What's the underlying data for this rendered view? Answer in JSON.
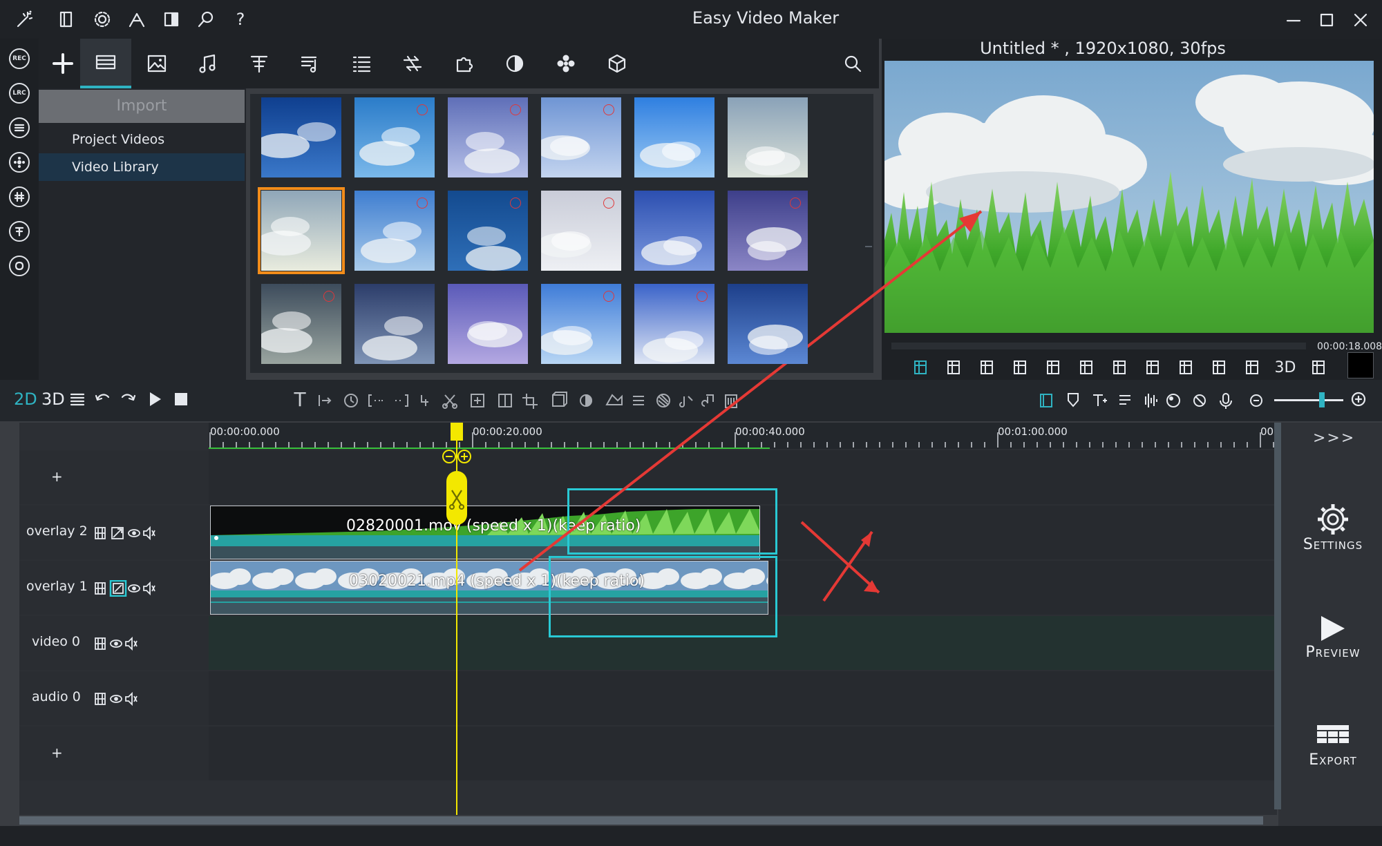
{
  "window": {
    "title": "Easy Video Maker",
    "min_label": "—",
    "max_label": "☐",
    "close_label": "✕"
  },
  "titlebar_icons": [
    "magic-wand-icon",
    "book-icon",
    "gear-icon",
    "pen-icon",
    "split-icon",
    "search-icon",
    "help-icon"
  ],
  "titlebar_help": "?",
  "rail": {
    "rec_label": "REC",
    "lrc_label": "LRC"
  },
  "library": {
    "import_label": "Import",
    "items": [
      {
        "label": "Project Videos"
      },
      {
        "label": "Video Library"
      }
    ],
    "selected_index": 1
  },
  "preview": {
    "title": "Untitled * , 1920x1080, 30fps",
    "time": "00:00:18.008",
    "mode_3d": "3D"
  },
  "timeline_toolbar": {
    "mode_2d": "2D",
    "mode_3d": "3D",
    "text_tool": "T"
  },
  "ruler": {
    "ticks": [
      "00:00:00.000",
      "00:00:20.000",
      "00:00:40.000",
      "00:01:00.000",
      "00:"
    ]
  },
  "tracks": [
    {
      "label": "+"
    },
    {
      "label": "overlay 2",
      "clip": "02820001.mov (speed x 1)(keep ratio)"
    },
    {
      "label": "overlay 1",
      "clip": "03020021.mp4 (speed x 1)(keep ratio)"
    },
    {
      "label": "video 0"
    },
    {
      "label": "audio 0"
    },
    {
      "label": "+"
    }
  ],
  "right_panel": {
    "expand": ">>>",
    "settings": "Settings",
    "preview": "Preview",
    "export": "Export"
  },
  "colors": {
    "accent": "#2fb3c2",
    "playhead": "#f3e800",
    "annotation": "#e53935",
    "selection": "#f28c1a"
  }
}
